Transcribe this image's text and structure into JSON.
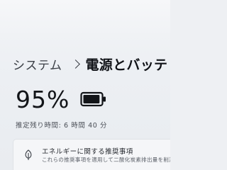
{
  "breadcrumb": {
    "root": "システム",
    "current": "電源とバッテリー"
  },
  "battery": {
    "percent_label": "95%",
    "percent": 95,
    "icon": "battery-icon",
    "remaining_label": "推定残り時間: 6 時間 40 分"
  },
  "recommendations": {
    "title": "エネルギーに関する推奨事項",
    "description": "これらの推奨事項を適用して二酸化炭素排出量を削減する",
    "icon": "leaf-icon"
  },
  "colors": {
    "background": "#eef0f3",
    "text_primary": "#121418",
    "card": "#f5f6f8"
  }
}
